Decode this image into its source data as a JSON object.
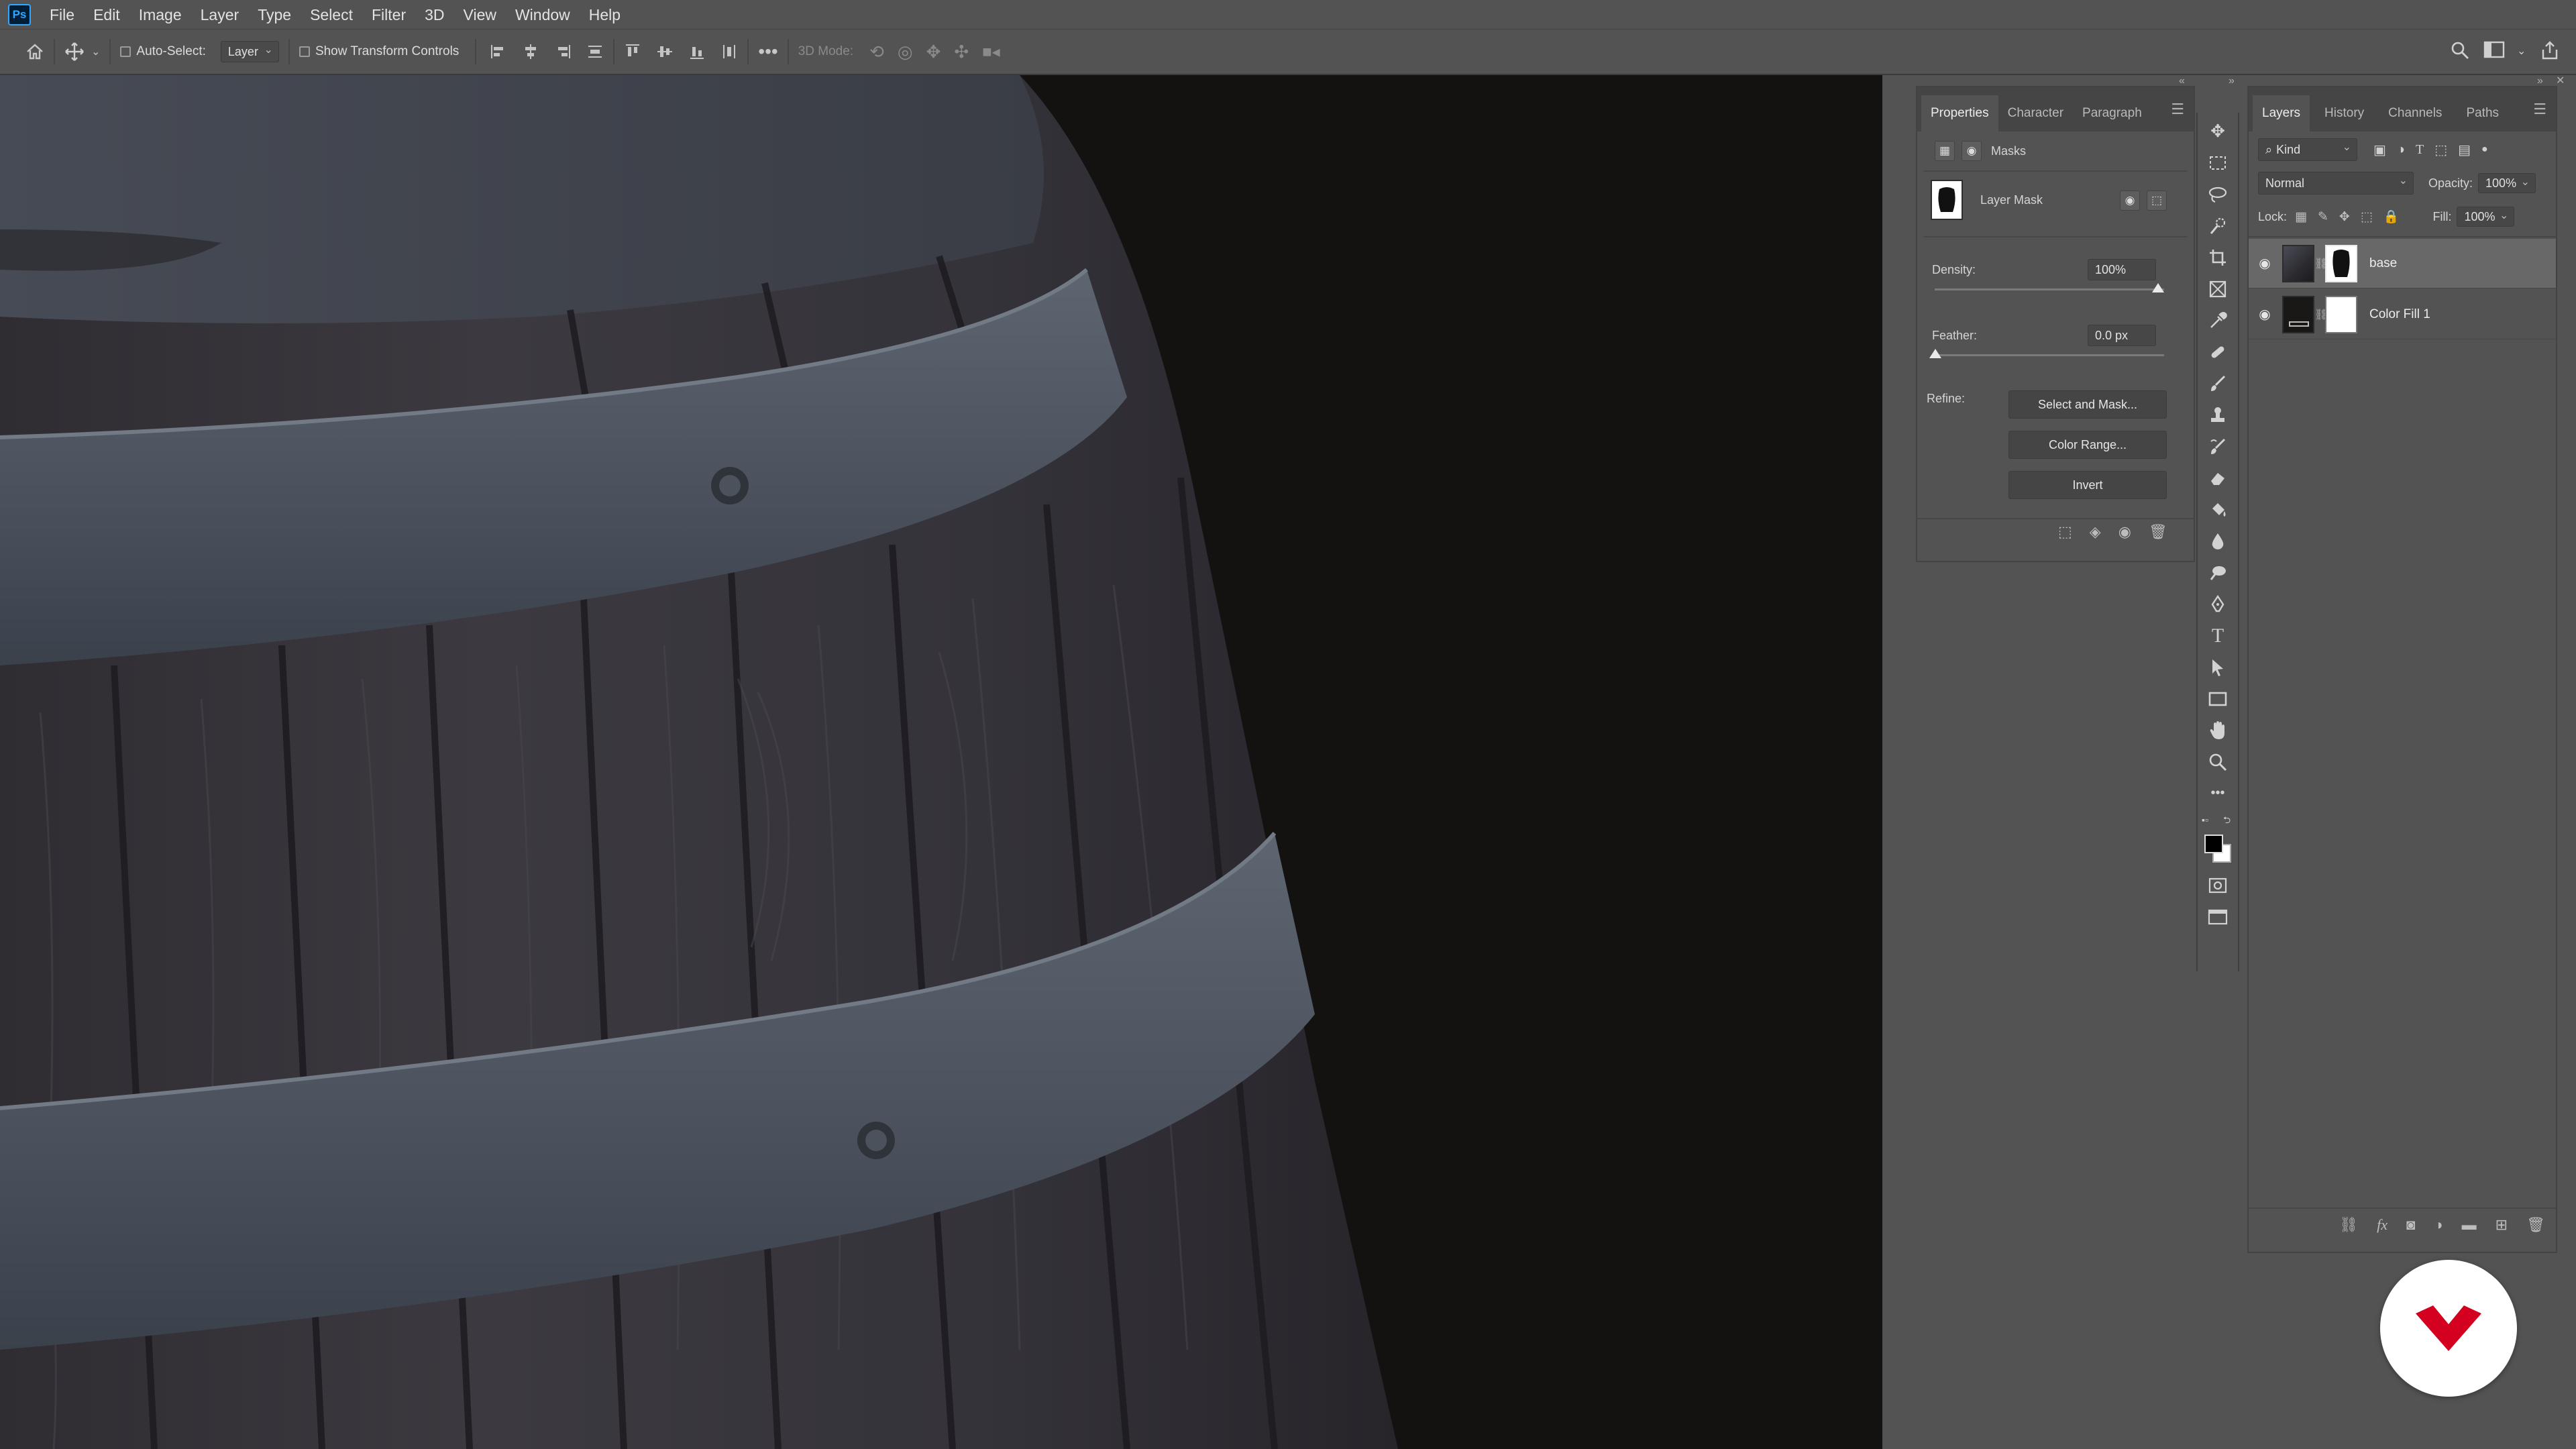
{
  "app": {
    "logo_text": "Ps"
  },
  "menu": [
    "File",
    "Edit",
    "Image",
    "Layer",
    "Type",
    "Select",
    "Filter",
    "3D",
    "View",
    "Window",
    "Help"
  ],
  "options_bar": {
    "auto_select_label": "Auto-Select:",
    "auto_select_value": "Layer",
    "show_transform_label": "Show Transform Controls",
    "mode_3d_label": "3D Mode:",
    "more_icon": "ellipsis-icon"
  },
  "properties": {
    "tabs": [
      "Properties",
      "Character",
      "Paragraph"
    ],
    "active_tab": "Properties",
    "section_label": "Masks",
    "mask_type": "Layer Mask",
    "density_label": "Density:",
    "density_value": "100%",
    "density": 1.0,
    "feather_label": "Feather:",
    "feather_value": "0.0 px",
    "feather": 0.0,
    "refine_label": "Refine:",
    "buttons": {
      "select_and_mask": "Select and Mask...",
      "color_range": "Color Range...",
      "invert": "Invert"
    }
  },
  "layers_panel": {
    "tabs": [
      "Layers",
      "History",
      "Channels",
      "Paths"
    ],
    "active_tab": "Layers",
    "filter_kind": "Kind",
    "blend_mode": "Normal",
    "opacity_label": "Opacity:",
    "opacity_value": "100%",
    "lock_label": "Lock:",
    "fill_label": "Fill:",
    "fill_value": "100%",
    "layers": [
      {
        "name": "base",
        "visible": true,
        "selected": true
      },
      {
        "name": "Color Fill 1",
        "visible": true,
        "selected": false
      }
    ]
  },
  "colors": {
    "ui_bg": "#535353",
    "canvas_bg": "#141210",
    "ps_blue": "#31a8ff",
    "brand_red": "#d4001f"
  }
}
